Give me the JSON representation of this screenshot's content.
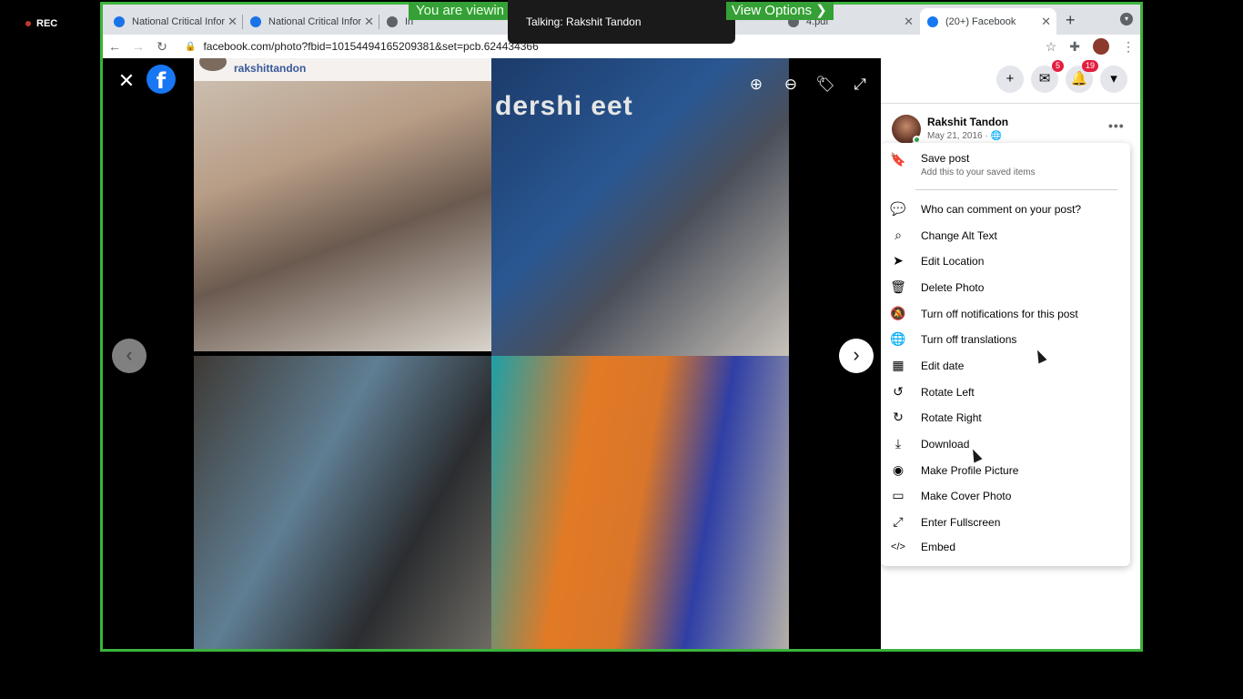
{
  "recording": {
    "label": "REC"
  },
  "zoom": {
    "banner_text": "You are viewin",
    "talking_label": "Talking: Rakshit Tandon",
    "view_options_label": "View Options ❯"
  },
  "browser": {
    "tabs": [
      {
        "title": "National Critical Infor",
        "favicon_color": "#1a73e8"
      },
      {
        "title": "National Critical Infor",
        "favicon_color": "#1a73e8"
      },
      {
        "title": "In",
        "favicon_color": "#5f6368"
      },
      {
        "title": "4.pdf",
        "favicon_color": "#5f6368"
      },
      {
        "title": "(20+) Facebook",
        "favicon_color": "#1877f2",
        "active": true
      }
    ],
    "url": "facebook.com/photo?fbid=10154494165209381&set=pcb.624434366"
  },
  "viewer": {
    "close_icon": "close-icon",
    "logo_letter": "f",
    "tools": [
      "zoom-in-icon",
      "zoom-out-icon",
      "tag-icon",
      "fullscreen-icon"
    ],
    "photo_caption": "rakshittandon",
    "photo_banner_text": "dershi eet"
  },
  "header": {
    "messenger_badge": "5",
    "notifications_badge": "19"
  },
  "post": {
    "author": "Rakshit Tandon",
    "date": "May 21, 2016 · 🌐"
  },
  "menu": {
    "save": {
      "label": "Save post",
      "sub": "Add this to your saved items",
      "icon": "bookmark-icon"
    },
    "items": [
      {
        "label": "Who can comment on your post?",
        "icon": "comment-icon"
      },
      {
        "label": "Change Alt Text",
        "icon": "search-icon"
      },
      {
        "label": "Edit Location",
        "icon": "location-icon"
      },
      {
        "label": "Delete Photo",
        "icon": "trash-icon"
      },
      {
        "label": "Turn off notifications for this post",
        "icon": "bell-off-icon"
      },
      {
        "label": "Turn off translations",
        "icon": "globe-icon"
      },
      {
        "label": "Edit date",
        "icon": "calendar-icon"
      },
      {
        "label": "Rotate Left",
        "icon": "rotate-left-icon"
      },
      {
        "label": "Rotate Right",
        "icon": "rotate-right-icon"
      },
      {
        "label": "Download",
        "icon": "download-icon"
      },
      {
        "label": "Make Profile Picture",
        "icon": "profile-icon"
      },
      {
        "label": "Make Cover Photo",
        "icon": "image-icon"
      },
      {
        "label": "Enter Fullscreen",
        "icon": "fullscreen-icon"
      },
      {
        "label": "Embed",
        "icon": "code-icon"
      }
    ]
  }
}
